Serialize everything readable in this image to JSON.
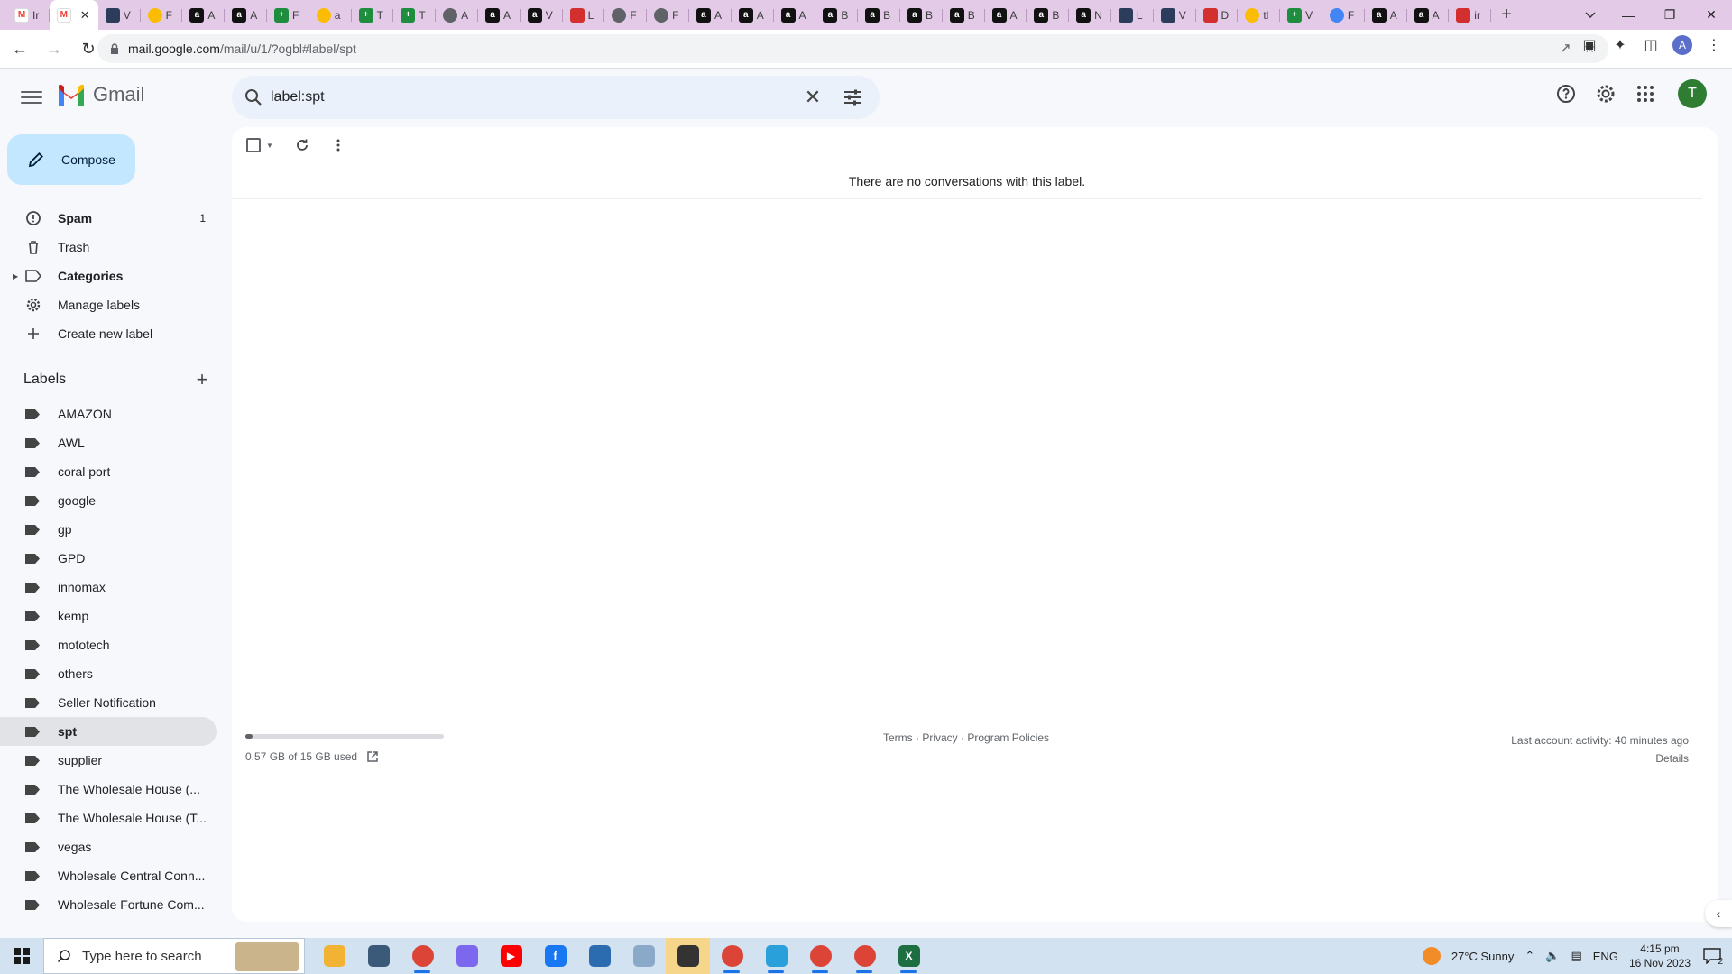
{
  "browser": {
    "tabs": [
      {
        "favicon": "gmail-icon",
        "title": "Ir",
        "active": false
      },
      {
        "favicon": "gmail-icon",
        "title": "",
        "active": true
      },
      {
        "favicon": "puzzle-icon",
        "title": "V",
        "active": false
      },
      {
        "favicon": "drive-icon",
        "title": "F",
        "active": false
      },
      {
        "favicon": "amazon-icon",
        "title": "A",
        "active": false
      },
      {
        "favicon": "amazon-icon",
        "title": "A",
        "active": false
      },
      {
        "favicon": "sheets-icon",
        "title": "F",
        "active": false
      },
      {
        "favicon": "drive-icon",
        "title": "a",
        "active": false
      },
      {
        "favicon": "sheets-icon",
        "title": "T",
        "active": false
      },
      {
        "favicon": "sheets-icon",
        "title": "T",
        "active": false
      },
      {
        "favicon": "globe-icon",
        "title": "A",
        "active": false
      },
      {
        "favicon": "amazon-icon",
        "title": "A",
        "active": false
      },
      {
        "favicon": "amazon-icon",
        "title": "V",
        "active": false
      },
      {
        "favicon": "red-icon",
        "title": "L",
        "active": false
      },
      {
        "favicon": "globe-icon",
        "title": "F",
        "active": false
      },
      {
        "favicon": "globe-icon",
        "title": "F",
        "active": false
      },
      {
        "favicon": "amazon-icon",
        "title": "A",
        "active": false
      },
      {
        "favicon": "amazon-icon",
        "title": "A",
        "active": false
      },
      {
        "favicon": "amazon-icon",
        "title": "A",
        "active": false
      },
      {
        "favicon": "amazon-icon",
        "title": "B",
        "active": false
      },
      {
        "favicon": "amazon-icon",
        "title": "B",
        "active": false
      },
      {
        "favicon": "amazon-icon",
        "title": "B",
        "active": false
      },
      {
        "favicon": "amazon-icon",
        "title": "B",
        "active": false
      },
      {
        "favicon": "amazon-icon",
        "title": "A",
        "active": false
      },
      {
        "favicon": "amazon-icon",
        "title": "B",
        "active": false
      },
      {
        "favicon": "amazon-icon",
        "title": "N",
        "active": false
      },
      {
        "favicon": "puzzle-icon",
        "title": "L",
        "active": false
      },
      {
        "favicon": "puzzle-icon",
        "title": "V",
        "active": false
      },
      {
        "favicon": "red-icon",
        "title": "D",
        "active": false
      },
      {
        "favicon": "drive-icon",
        "title": "tl",
        "active": false
      },
      {
        "favicon": "sheets-icon",
        "title": "V",
        "active": false
      },
      {
        "favicon": "photos-icon",
        "title": "F",
        "active": false
      },
      {
        "favicon": "amazon-icon",
        "title": "A",
        "active": false
      },
      {
        "favicon": "amazon-icon",
        "title": "A",
        "active": false
      },
      {
        "favicon": "red-icon",
        "title": "ir",
        "active": false
      }
    ],
    "new_tab": "+",
    "url_host": "mail.google.com",
    "url_path": "/mail/u/1/?ogbl#label/spt",
    "profile_initial": "A"
  },
  "gmail": {
    "logo_text": "Gmail",
    "search": {
      "value": "label:spt"
    },
    "avatar_initial": "T",
    "compose_label": "Compose",
    "nav": [
      {
        "label": "Spam",
        "icon": "report-icon",
        "count": "1",
        "bold": true
      },
      {
        "label": "Trash",
        "icon": "trash-icon",
        "count": "",
        "bold": false
      },
      {
        "label": "Categories",
        "icon": "label-outline-icon",
        "count": "",
        "bold": true,
        "caret": true
      },
      {
        "label": "Manage labels",
        "icon": "gear-icon",
        "count": "",
        "bold": false
      },
      {
        "label": "Create new label",
        "icon": "plus-icon",
        "count": "",
        "bold": false
      }
    ],
    "labels_heading": "Labels",
    "labels": [
      {
        "label": "AMAZON",
        "active": false
      },
      {
        "label": "AWL",
        "active": false
      },
      {
        "label": "coral port",
        "active": false
      },
      {
        "label": "google",
        "active": false
      },
      {
        "label": "gp",
        "active": false
      },
      {
        "label": "GPD",
        "active": false
      },
      {
        "label": "innomax",
        "active": false
      },
      {
        "label": "kemp",
        "active": false
      },
      {
        "label": "mototech",
        "active": false
      },
      {
        "label": "others",
        "active": false
      },
      {
        "label": "Seller Notification",
        "active": false
      },
      {
        "label": "spt",
        "active": true
      },
      {
        "label": "supplier",
        "active": false
      },
      {
        "label": "The Wholesale House (...",
        "active": false
      },
      {
        "label": "The Wholesale House (T...",
        "active": false
      },
      {
        "label": "vegas",
        "active": false
      },
      {
        "label": "Wholesale Central Conn...",
        "active": false
      },
      {
        "label": "Wholesale Fortune Com...",
        "active": false
      }
    ],
    "empty_message": "There are no conversations with this label.",
    "storage": {
      "text": "0.57 GB of 15 GB used",
      "fraction": 0.038
    },
    "footer": {
      "terms": "Terms",
      "privacy": "Privacy",
      "policies": "Program Policies",
      "sep": " · "
    },
    "activity": {
      "text": "Last account activity: 40 minutes ago",
      "details": "Details"
    }
  },
  "taskbar": {
    "search_placeholder": "Type here to search",
    "weather": "27°C  Sunny",
    "lang": "ENG",
    "time": "4:15 pm",
    "date": "16 Nov 2023",
    "notifications": "2",
    "apps": [
      {
        "name": "file-explorer-icon",
        "color": "#f2b233",
        "glyph": "",
        "active": false
      },
      {
        "name": "calculator-icon",
        "color": "#3b5a7a",
        "glyph": "",
        "active": false
      },
      {
        "name": "chrome-icon",
        "color": "#db4437",
        "glyph": "",
        "active": false,
        "under": true
      },
      {
        "name": "copilot-icon",
        "color": "#7b68ee",
        "glyph": "",
        "active": false
      },
      {
        "name": "youtube-icon",
        "color": "#ff0000",
        "glyph": "▶",
        "active": false
      },
      {
        "name": "facebook-icon",
        "color": "#1877f2",
        "glyph": "f",
        "active": false
      },
      {
        "name": "store-icon",
        "color": "#2b6cb0",
        "glyph": "",
        "active": false
      },
      {
        "name": "snip-icon",
        "color": "#8aa9c9",
        "glyph": "",
        "active": false
      },
      {
        "name": "sticky-notes-icon",
        "color": "#333333",
        "glyph": "",
        "active": true
      },
      {
        "name": "chrome-icon",
        "color": "#db4437",
        "glyph": "",
        "active": false,
        "under": true
      },
      {
        "name": "telegram-icon",
        "color": "#2aa0da",
        "glyph": "",
        "active": false,
        "under": true
      },
      {
        "name": "chrome-icon",
        "color": "#db4437",
        "glyph": "",
        "active": false,
        "under": true
      },
      {
        "name": "chrome-icon",
        "color": "#db4437",
        "glyph": "",
        "active": false,
        "under": true
      },
      {
        "name": "excel-icon",
        "color": "#1d6f42",
        "glyph": "X",
        "active": false,
        "under": true
      }
    ]
  }
}
